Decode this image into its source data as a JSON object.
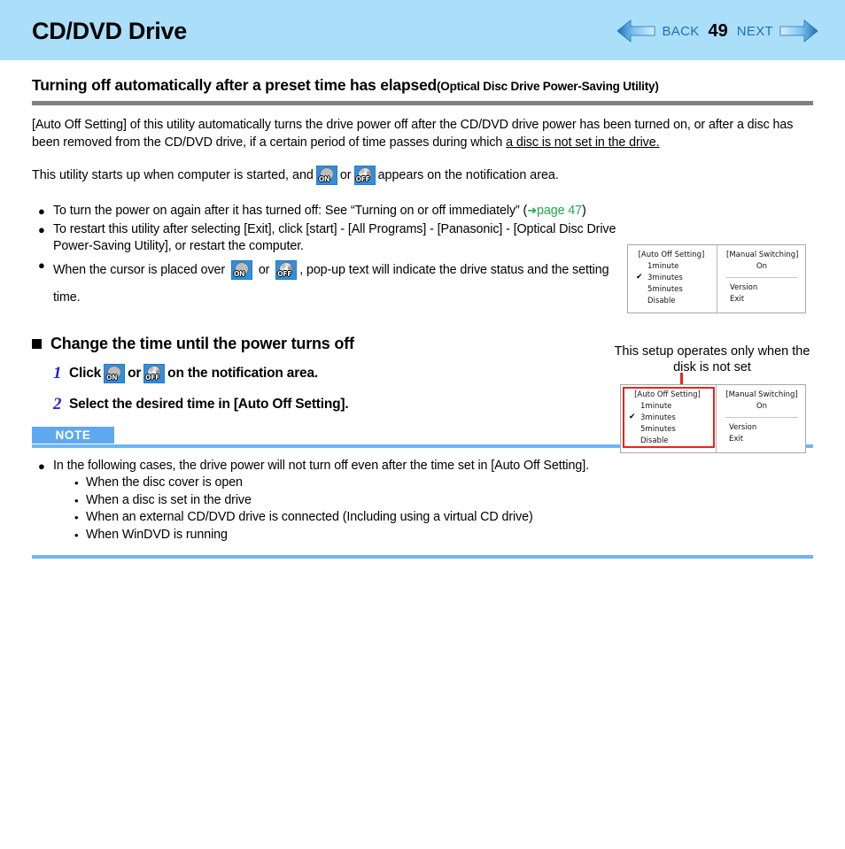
{
  "header": {
    "title": "CD/DVD Drive",
    "back_label": "BACK",
    "page_number": "49",
    "next_label": "NEXT",
    "back_icon": "left-arrow-icon",
    "next_icon": "right-arrow-icon",
    "background_color": "#abdef9",
    "nav_text_color": "#1f6fb8"
  },
  "section": {
    "heading": "Turning off automatically after a preset time has elapsed",
    "heading_sub": "(Optical Disc Drive Power-Saving Utility)"
  },
  "intro": {
    "p1_a": "[Auto Off Setting] of this utility automatically turns the drive power off after the CD/DVD drive power has been turned on, or after a disc has been removed from the CD/DVD drive, if a certain period of time passes during which ",
    "p1_underlined": "a disc is not set in the drive.",
    "p2_a": "This utility starts up when computer is started, and",
    "p2_or": "or",
    "p2_b": "appears on the notification area."
  },
  "bullets": [
    {
      "text_a": "To turn the power on again after it has turned off: See “Turning on or off immediately” (",
      "link_arrow": "➜",
      "link": "page 47",
      "text_b": ")"
    },
    {
      "text_a": "To restart this utility after selecting [Exit], click [start] - [All Programs] - [Panasonic] - [Optical Disc Drive Power-Saving Utility], or restart the computer."
    },
    {
      "text_a": "When the cursor is placed over",
      "text_or": "or",
      "text_b": ", pop-up text will indicate the drive status and the setting time."
    }
  ],
  "subsection": {
    "heading": "Change the time until the power turns off",
    "steps": [
      {
        "num": "1",
        "text_a": "Click",
        "text_or": "or",
        "text_b": "on the notification area."
      },
      {
        "num": "2",
        "text_a": "Select the desired time in [Auto Off Setting]."
      }
    ]
  },
  "note": {
    "badge": "NOTE",
    "main": "In the following cases, the drive power will not turn off even after the time set in [Auto Off Setting].",
    "items": [
      "When the disc cover is open",
      "When a disc is set in the drive",
      "When an external CD/DVD drive is connected (Including using a virtual CD drive)",
      "When WinDVD is running"
    ],
    "bullet_glyph": "●",
    "sub_glyph": "•",
    "accent_color": "#5ea8f2"
  },
  "tray_icons": {
    "on_label": "ON",
    "off_label": "OFF"
  },
  "menu_shot_1": {
    "left_title": "[Auto Off Setting]",
    "left_items": [
      {
        "label": "1minute",
        "checked": false
      },
      {
        "label": "3minutes",
        "checked": true
      },
      {
        "label": "5minutes",
        "checked": false
      },
      {
        "label": "Disable",
        "checked": false
      }
    ],
    "right_title": "[Manual Switching]",
    "right_on": "On",
    "right_items": [
      "Version",
      "Exit"
    ]
  },
  "menu_shot_2": {
    "callout": "This setup operates only when the disk is not set",
    "highlight_color": "#e8261c",
    "left_title": "[Auto Off Setting]",
    "left_items": [
      {
        "label": "1minute",
        "checked": false
      },
      {
        "label": "3minutes",
        "checked": true
      },
      {
        "label": "5minutes",
        "checked": false
      },
      {
        "label": "Disable",
        "checked": false
      }
    ],
    "right_title": "[Manual Switching]",
    "right_on": "On",
    "right_items": [
      "Version",
      "Exit"
    ]
  }
}
